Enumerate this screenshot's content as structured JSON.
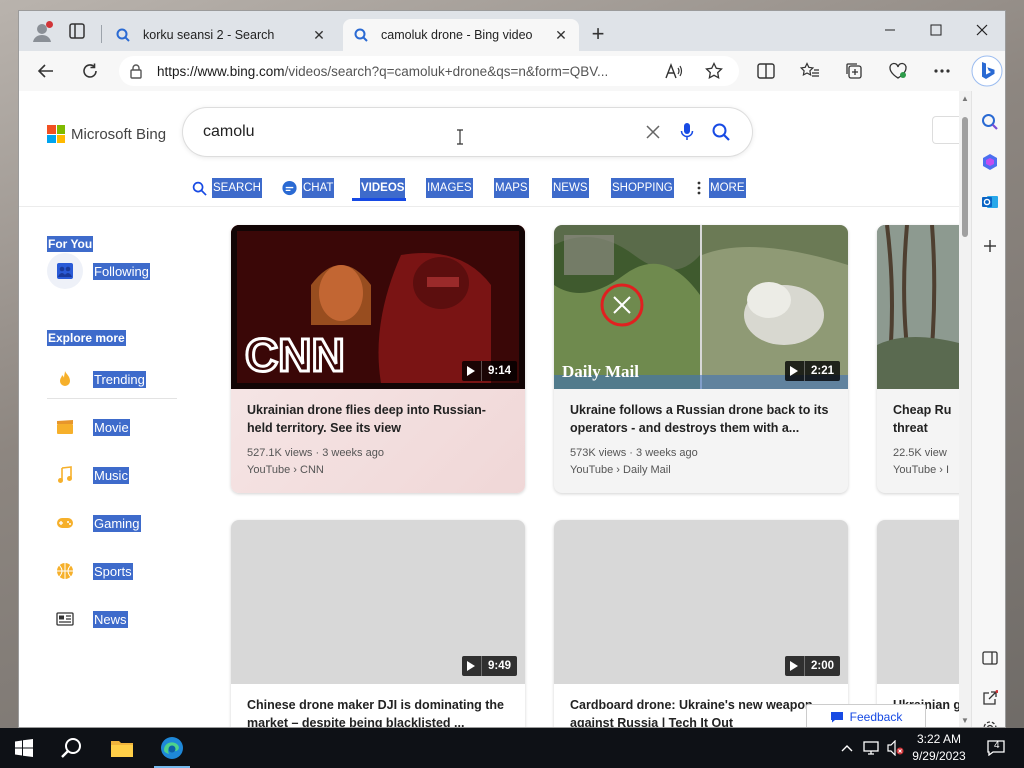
{
  "browser": {
    "tabs": [
      {
        "title": "korku seansi 2 - Search",
        "active": false
      },
      {
        "title": "camoluk drone - Bing video",
        "active": true
      }
    ],
    "url_host": "https://www.bing.com",
    "url_path": "/videos/search?q=camoluk+drone&qs=n&form=QBV..."
  },
  "bing": {
    "logo_text": "Microsoft Bing",
    "query": "camolu",
    "scopes": [
      {
        "label": "SEARCH",
        "icon": "search-icon"
      },
      {
        "label": "CHAT",
        "icon": "chat-icon"
      },
      {
        "label": "VIDEOS",
        "icon": "",
        "selected": true
      },
      {
        "label": "IMAGES",
        "icon": ""
      },
      {
        "label": "MAPS",
        "icon": ""
      },
      {
        "label": "NEWS",
        "icon": ""
      },
      {
        "label": "SHOPPING",
        "icon": ""
      },
      {
        "label": "MORE",
        "icon": "more-vertical-icon"
      }
    ]
  },
  "sidebar": {
    "for_you": "For You",
    "following": "Following",
    "explore_more": "Explore more",
    "items": [
      {
        "label": "Trending",
        "icon": "flame-icon"
      },
      {
        "label": "Movie",
        "icon": "clapperboard-icon"
      },
      {
        "label": "Music",
        "icon": "music-note-icon"
      },
      {
        "label": "Gaming",
        "icon": "gamepad-icon"
      },
      {
        "label": "Sports",
        "icon": "ball-icon"
      },
      {
        "label": "News",
        "icon": "newspaper-icon"
      }
    ]
  },
  "videos": [
    {
      "title": "Ukrainian drone flies deep into Russian-held territory. See its view",
      "views": "527.1K views · 3 weeks ago",
      "source": "YouTube › CNN",
      "duration": "9:14",
      "thumb_text": "CNN"
    },
    {
      "title": "Ukraine follows a Russian drone back to its operators - and destroys them with a...",
      "views": "573K views · 3 weeks ago",
      "source": "YouTube › Daily Mail",
      "duration": "2:21",
      "thumb_text": "Daily Mail"
    },
    {
      "title": "Cheap Ru threat",
      "views": "22.5K view",
      "source": "YouTube › I",
      "duration": ""
    },
    {
      "title": "Chinese drone maker DJI is dominating the market – despite being blacklisted ...",
      "duration": "9:49"
    },
    {
      "title": "Cardboard drone: Ukraine's new weapon against Russia | Tech It Out",
      "duration": "2:00"
    },
    {
      "title": "Ukrainian g it o",
      "duration": ""
    }
  ],
  "feedback_label": "Feedback",
  "taskbar": {
    "time": "3:22 AM",
    "date": "9/29/2023",
    "notification_count": "4"
  },
  "colors": {
    "selection_blue": "#3e6bcb",
    "bing_blue": "#174ae4",
    "cnn_red": "#cc0000"
  }
}
